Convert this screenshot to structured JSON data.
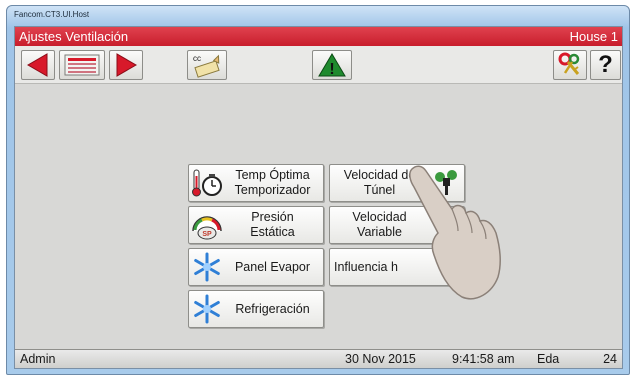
{
  "window": {
    "title": "Fancom.CT3.UI.Host"
  },
  "titlebar": {
    "screen_title": "Ajustes Ventilación",
    "house": "House 1"
  },
  "toolbar": {
    "icons": [
      "arrow-left-icon",
      "list-icon",
      "arrow-right-icon",
      "cc-pencil-icon",
      "warning-icon",
      "keys-icon",
      "help-icon"
    ],
    "cc_label": "cc",
    "help_label": "?",
    "warning_mark": "!"
  },
  "grid": {
    "buttons": [
      {
        "label": "Temp Óptima\nTemporizador",
        "icon": "thermometer-clock-icon"
      },
      {
        "label": "Velocidad de\nTúnel",
        "icon": "tunnel-fan-icon"
      },
      {
        "label": "Presión\nEstática",
        "icon": "static-pressure-gauge-icon",
        "icon_text": "SP"
      },
      {
        "label": "Velocidad\nVariable",
        "icon": "variable-speed-icon"
      },
      {
        "label": "Panel Evapor",
        "icon": "snowflake-icon"
      },
      {
        "label": "Influencia h",
        "icon": ""
      },
      {
        "label": "Refrigeración",
        "icon": "snowflake-icon"
      }
    ]
  },
  "statusbar": {
    "user": "Admin",
    "date": "30 Nov 2015",
    "time": "9:41:58 am",
    "mode": "Eda",
    "day": "24"
  },
  "colors": {
    "title_red": "#c81d2c",
    "client_bg": "#d8d8d6",
    "arrow_red": "#d8192a",
    "warning_green": "#1f8a2e"
  }
}
